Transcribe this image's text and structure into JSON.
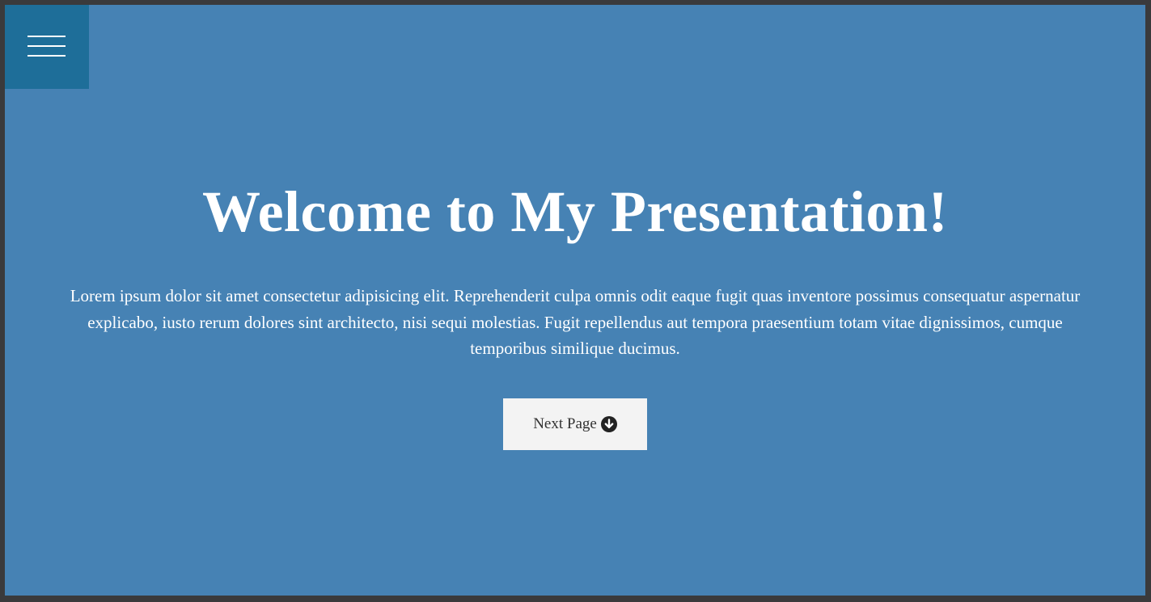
{
  "menu": {
    "icon": "hamburger-menu-icon",
    "bg_color": "#1e6e99"
  },
  "hero": {
    "title": "Welcome to My Presentation!",
    "text": "Lorem ipsum dolor sit amet consectetur adipisicing elit. Reprehenderit culpa omnis odit eaque fugit quas inventore possimus consequatur aspernatur explicabo, iusto rerum dolores sint architecto, nisi sequi molestias. Fugit repellendus aut tempora praesentium totam vitae dignissimos, cumque temporibus similique ducimus.",
    "background_color": "#4682b4",
    "text_color": "#ffffff"
  },
  "next_button": {
    "label": "Next Page",
    "icon": "arrow-circle-down-icon",
    "bg_color": "#f3f3f3"
  }
}
